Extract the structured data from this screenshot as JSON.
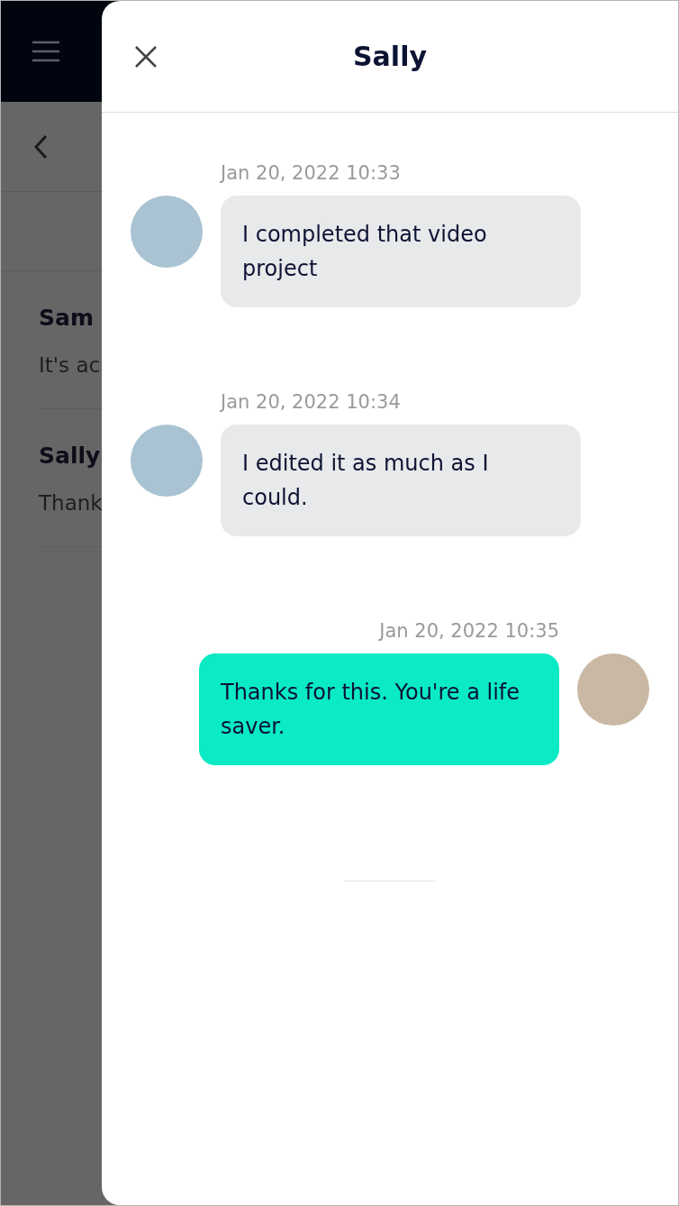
{
  "conversations": [
    {
      "name": "Sam",
      "preview": "It's ac"
    },
    {
      "name": "Sally",
      "preview": "Thank"
    }
  ],
  "chat": {
    "title": "Sally",
    "messages": [
      {
        "kind": "incoming",
        "timestamp": "Jan 20, 2022 10:33",
        "text": "I completed that video project"
      },
      {
        "kind": "incoming",
        "timestamp": "Jan 20, 2022 10:34",
        "text": "I edited it as much as I could."
      },
      {
        "kind": "outgoing",
        "timestamp": "Jan 20, 2022 10:35",
        "text": "Thanks for this. You're a life saver."
      }
    ]
  }
}
